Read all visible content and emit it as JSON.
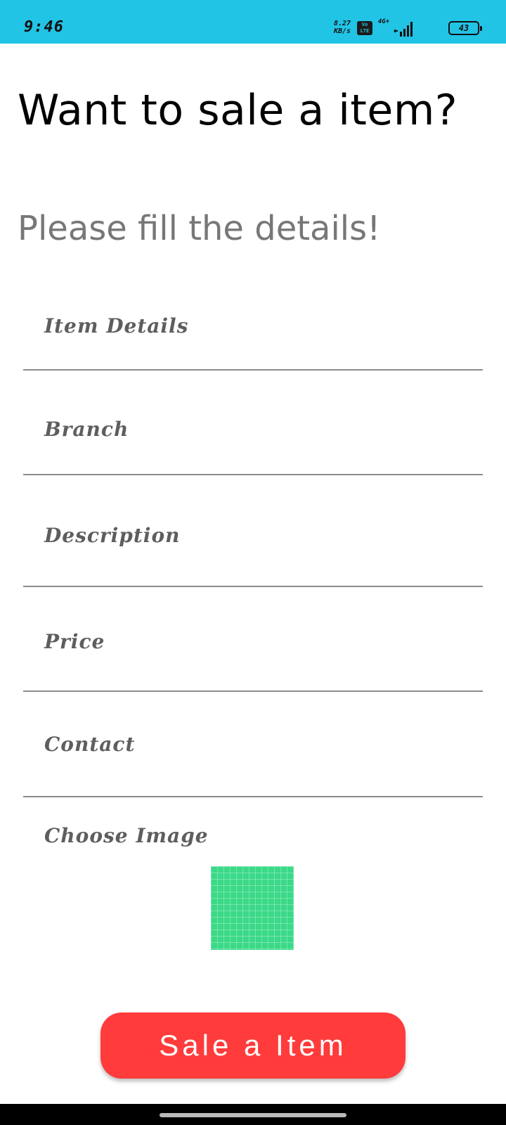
{
  "status_bar": {
    "time": "9:46",
    "net_speed_value": "8.27",
    "net_speed_unit": "KB/s",
    "volte_line1": "Vo",
    "volte_line2": "LTE",
    "network_type": "4G+",
    "battery_level": "43",
    "bg_color": "#22c4e6"
  },
  "header": {
    "title": "Want to sale a item?",
    "subtitle": "Please fill the details!"
  },
  "form": {
    "fields": [
      {
        "label": "Item  Details"
      },
      {
        "label": "Branch"
      },
      {
        "label": "Description"
      },
      {
        "label": "Price"
      },
      {
        "label": "Contact"
      }
    ],
    "image_label": "Choose  Image",
    "image_icon": "image-picker-icon",
    "image_color": "#3bd988"
  },
  "submit_button": {
    "label": "Sale a Item",
    "color": "#ff3b3b"
  }
}
